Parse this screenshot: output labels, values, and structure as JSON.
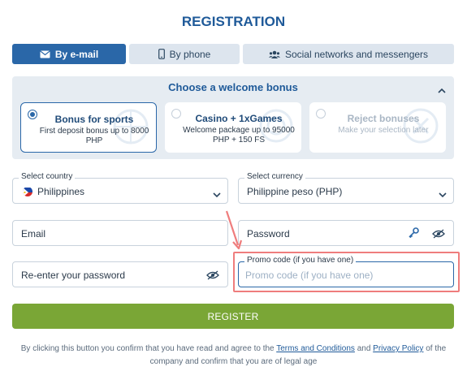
{
  "page": {
    "title": "REGISTRATION"
  },
  "tabs": [
    {
      "label": "By e-mail",
      "icon": "envelope-icon",
      "active": true
    },
    {
      "label": "By phone",
      "icon": "phone-icon",
      "active": false
    },
    {
      "label": "Social networks and messengers",
      "icon": "people-icon",
      "active": false
    }
  ],
  "bonus": {
    "heading": "Choose a welcome bonus",
    "options": [
      {
        "title": "Bonus for sports",
        "desc": "First deposit bonus up to 8000 PHP",
        "selected": true
      },
      {
        "title": "Casino + 1xGames",
        "desc": "Welcome package up to 95000 PHP + 150 FS",
        "selected": false
      },
      {
        "title": "Reject bonuses",
        "desc": "Make your selection later",
        "selected": false
      }
    ]
  },
  "form": {
    "country": {
      "label": "Select country",
      "value": "Philippines"
    },
    "currency": {
      "label": "Select currency",
      "value": "Philippine peso (PHP)"
    },
    "email": {
      "placeholder": "Email"
    },
    "password": {
      "placeholder": "Password"
    },
    "reenter": {
      "placeholder": "Re-enter your password"
    },
    "promo": {
      "label": "Promo code (if you have one)",
      "placeholder": "Promo code (if you have one)"
    }
  },
  "register_label": "REGISTER",
  "disclaimer": {
    "before": "By clicking this button you confirm that you have read and agree to the ",
    "terms": "Terms and Conditions",
    "and": " and ",
    "privacy": "Privacy Policy",
    "after": " of the company and confirm that you are of legal age"
  },
  "colors": {
    "accent": "#2a67a8",
    "register": "#7aa636",
    "highlight": "#ef7d7d"
  }
}
